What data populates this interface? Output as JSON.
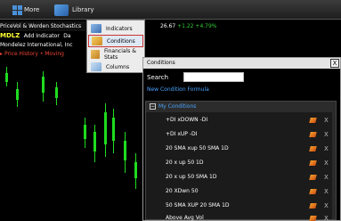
{
  "toolbar": {
    "more_label": "More",
    "library_label": "Library"
  },
  "chart": {
    "row1": "PriceVol & Worden Stochastics",
    "row2_symbol": "MDLZ",
    "row2_action": "Add Indicator",
    "row2_extra": "Da",
    "row3": "Mondelez International, Inc",
    "row4": "Price History • Moving",
    "quote_price": "26.67",
    "quote_change": "+1.22",
    "quote_percent": "+4.79%"
  },
  "menu": {
    "items": [
      {
        "label": "Indicators",
        "icon": "indicators-icon"
      },
      {
        "label": "Conditions",
        "icon": "conditions-icon",
        "selected": true
      },
      {
        "label": "Financials & Stats",
        "icon": "financials-icon"
      },
      {
        "label": "Columns",
        "icon": "columns-icon"
      }
    ]
  },
  "dialog": {
    "title": "Conditions",
    "close_glyph": "X",
    "search_label": "Search",
    "search_value": "",
    "new_condition": "New Condition Formula",
    "group_toggle": "−",
    "group_label": "My Conditions",
    "conditions": [
      "+DI xDOWN -DI",
      "+DI xUP -DI",
      "20 SMA xup 50 SMA 1D",
      "20 x up 50 1D",
      "20 x up 50 SMA  1D",
      "20 XDwn 50",
      "50 SMA XUP 20 SMA 1D",
      "Above Avg Vol"
    ],
    "delete_glyph": "X"
  },
  "colors": {
    "accent_blue": "#4aa3ff",
    "candle_green": "#1fdc1f",
    "highlight_red": "#cc3333",
    "symbol_yellow": "#ffff33"
  }
}
